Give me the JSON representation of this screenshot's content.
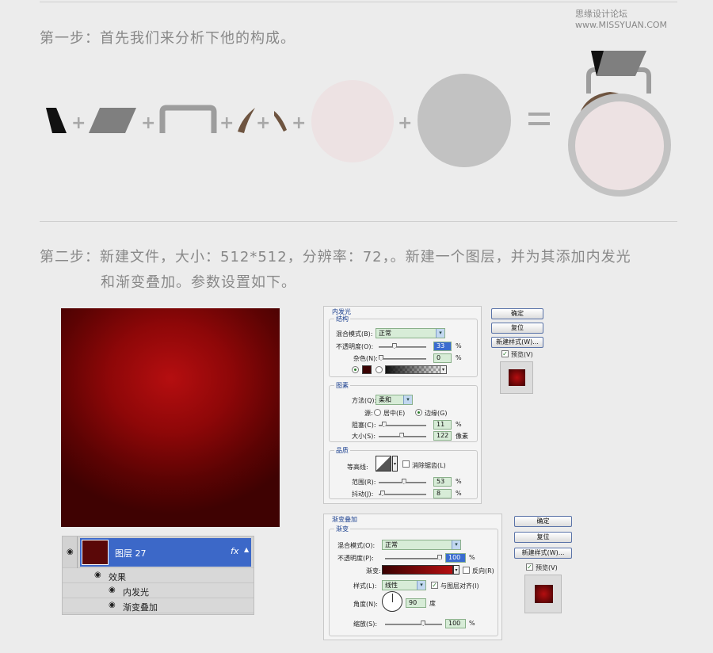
{
  "watermark": "思缘设计论坛 www.MISSYUAN.COM",
  "step1": {
    "text": "第一步：首先我们来分析下他的构成。"
  },
  "step2": {
    "line1": "第二步：新建文件，大小：512*512，分辨率：72，。新建一个图层，并为其添加内发光",
    "line2": "和渐变叠加。参数设置如下。"
  },
  "diagram": {
    "plus": "+",
    "equals": "="
  },
  "colors": {
    "canvas_center": "#b50e10",
    "canvas_edge": "#3f0202",
    "piece_dark": "#111111",
    "piece_gray": "#7f7f7f",
    "frame_gray": "#9d9d9d",
    "horn_brown": "#6e5440",
    "pink": "#ede2e3",
    "big_gray": "#c2c2c2"
  },
  "inner_glow": {
    "title": "内发光",
    "structure": {
      "title": "结构",
      "blend_mode_label": "混合模式(B):",
      "blend_mode_value": "正常",
      "opacity_label": "不透明度(O):",
      "opacity_value": "33",
      "opacity_pct": 33,
      "noise_label": "杂色(N):",
      "noise_value": "0",
      "noise_pct": 0,
      "pct": "%"
    },
    "elements": {
      "title": "图素",
      "method_label": "方法(Q):",
      "method_value": "柔和",
      "source_label": "源:",
      "source_center": "居中(E)",
      "source_edge": "边缘(G)",
      "choke_label": "阻塞(C):",
      "choke_value": "11",
      "choke_pct": 11,
      "size_label": "大小(S):",
      "size_value": "122",
      "size_pct": 49,
      "pct": "%",
      "px": "像素"
    },
    "quality": {
      "title": "品质",
      "contour_label": "等高线:",
      "antialias_label": "消除锯齿(L)",
      "range_label": "范围(R):",
      "range_value": "53",
      "range_pct": 53,
      "jitter_label": "抖动(J):",
      "jitter_value": "8",
      "jitter_pct": 8,
      "pct": "%"
    },
    "buttons": {
      "ok": "确定",
      "reset": "复位",
      "new_style": "新建样式(W)...",
      "preview": "预览(V)"
    }
  },
  "gradient_overlay": {
    "title": "渐变叠加",
    "section": "渐变",
    "blend_mode_label": "混合模式(O):",
    "blend_mode_value": "正常",
    "opacity_label": "不透明度(P):",
    "opacity_value": "100",
    "opacity_pct": 100,
    "gradient_label": "渐变:",
    "reverse_label": "反向(R)",
    "style_label": "样式(L):",
    "style_value": "线性",
    "align_label": "与图层对齐(I)",
    "angle_label": "角度(N):",
    "angle_value": "90",
    "angle_unit": "度",
    "scale_label": "缩放(S):",
    "scale_value": "100",
    "scale_pct": 67,
    "pct": "%",
    "buttons": {
      "ok": "确定",
      "reset": "复位",
      "new_style": "新建样式(W)...",
      "preview": "预览(V)"
    }
  },
  "layers": {
    "layer_name": "图层 27",
    "fx": "fx",
    "effects": "效果",
    "effect1": "内发光",
    "effect2": "渐变叠加"
  }
}
